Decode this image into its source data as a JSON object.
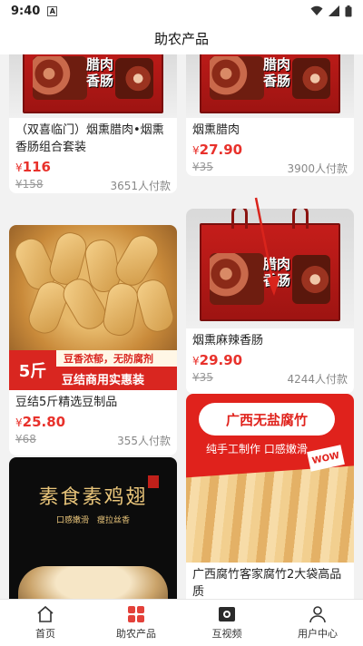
{
  "status_bar": {
    "time": "9:40",
    "indicator": "A"
  },
  "header": {
    "title": "助农产品"
  },
  "products": [
    {
      "name": "（双喜临门）烟熏腊肉•烟熏香肠组合套装",
      "price": "116",
      "currency": "¥",
      "original_price": "¥158",
      "sold": "3651人付款",
      "image": "gift-box",
      "box_text": [
        "腊肉",
        "香肠"
      ]
    },
    {
      "name": "烟熏腊肉",
      "price": "27.90",
      "currency": "¥",
      "original_price": "¥35",
      "sold": "3900人付款",
      "image": "gift-box",
      "box_text": [
        "腊肉",
        "香肠"
      ]
    },
    {
      "name": "豆结5斤精选豆制品",
      "price": "25.80",
      "currency": "¥",
      "original_price": "¥68",
      "sold": "355人付款",
      "image": "yuba-knots",
      "banner": {
        "tag": "5斤",
        "top": "豆香浓郁，无防腐剂",
        "bottom": "豆结商用实惠装"
      }
    },
    {
      "name": "烟熏麻辣香肠",
      "price": "29.90",
      "currency": "¥",
      "original_price": "¥35",
      "sold": "4244人付款",
      "image": "gift-box",
      "box_text": [
        "腊肉",
        "香肠"
      ]
    },
    {
      "name": "",
      "image": "sujixi",
      "poster": {
        "title": "素食素鸡翅",
        "sub": "口感嫩滑　瘦拉丝香"
      }
    },
    {
      "name": "广西腐竹客家腐竹2大袋高品质",
      "image": "guangxi-fuzhu",
      "poster": {
        "title": "广西无盐腐竹",
        "sub": "纯手工制作 口感嫩滑",
        "badge": "WOW"
      }
    }
  ],
  "tabbar": [
    {
      "label": "首页",
      "icon": "home-icon"
    },
    {
      "label": "助农产品",
      "icon": "grid-icon",
      "active": true
    },
    {
      "label": "互视频",
      "icon": "video-icon"
    },
    {
      "label": "用户中心",
      "icon": "user-icon"
    }
  ],
  "colors": {
    "price": "#e8312b",
    "accent": "#e3413a",
    "arrow": "#d9241c"
  }
}
